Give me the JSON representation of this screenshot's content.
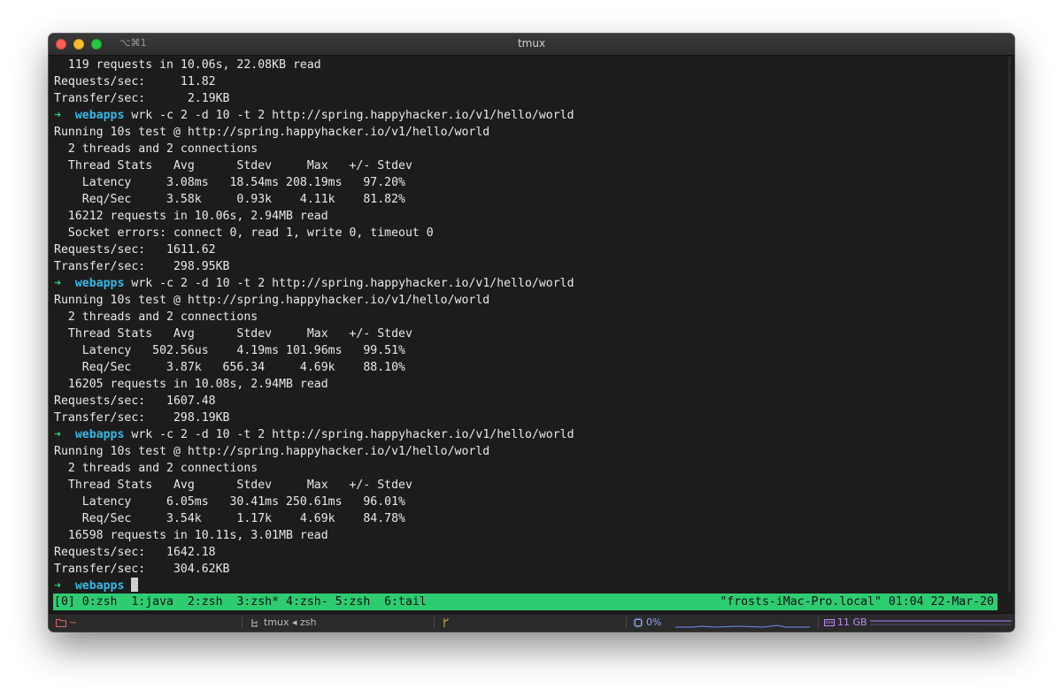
{
  "window": {
    "title": "tmux",
    "shortcut": "⌥⌘1"
  },
  "terminal": {
    "lines": [
      {
        "type": "text",
        "text": "  119 requests in 10.06s, 22.08KB read"
      },
      {
        "type": "text",
        "text": "Requests/sec:     11.82"
      },
      {
        "type": "text",
        "text": "Transfer/sec:      2.19KB"
      },
      {
        "type": "prompt",
        "arrow": "➜",
        "dir": "webapps",
        "cmd": "wrk -c 2 -d 10 -t 2 http://spring.happyhacker.io/v1/hello/world"
      },
      {
        "type": "text",
        "text": "Running 10s test @ http://spring.happyhacker.io/v1/hello/world"
      },
      {
        "type": "text",
        "text": "  2 threads and 2 connections"
      },
      {
        "type": "text",
        "text": "  Thread Stats   Avg      Stdev     Max   +/- Stdev"
      },
      {
        "type": "text",
        "text": "    Latency     3.08ms   18.54ms 208.19ms   97.20%"
      },
      {
        "type": "text",
        "text": "    Req/Sec     3.58k     0.93k    4.11k    81.82%"
      },
      {
        "type": "text",
        "text": "  16212 requests in 10.06s, 2.94MB read"
      },
      {
        "type": "text",
        "text": "  Socket errors: connect 0, read 1, write 0, timeout 0"
      },
      {
        "type": "text",
        "text": "Requests/sec:   1611.62"
      },
      {
        "type": "text",
        "text": "Transfer/sec:    298.95KB"
      },
      {
        "type": "prompt",
        "arrow": "➜",
        "dir": "webapps",
        "cmd": "wrk -c 2 -d 10 -t 2 http://spring.happyhacker.io/v1/hello/world"
      },
      {
        "type": "text",
        "text": "Running 10s test @ http://spring.happyhacker.io/v1/hello/world"
      },
      {
        "type": "text",
        "text": "  2 threads and 2 connections"
      },
      {
        "type": "text",
        "text": "  Thread Stats   Avg      Stdev     Max   +/- Stdev"
      },
      {
        "type": "text",
        "text": "    Latency   502.56us    4.19ms 101.96ms   99.51%"
      },
      {
        "type": "text",
        "text": "    Req/Sec     3.87k   656.34     4.69k    88.10%"
      },
      {
        "type": "text",
        "text": "  16205 requests in 10.08s, 2.94MB read"
      },
      {
        "type": "text",
        "text": "Requests/sec:   1607.48"
      },
      {
        "type": "text",
        "text": "Transfer/sec:    298.19KB"
      },
      {
        "type": "prompt",
        "arrow": "➜",
        "dir": "webapps",
        "cmd": "wrk -c 2 -d 10 -t 2 http://spring.happyhacker.io/v1/hello/world"
      },
      {
        "type": "text",
        "text": "Running 10s test @ http://spring.happyhacker.io/v1/hello/world"
      },
      {
        "type": "text",
        "text": "  2 threads and 2 connections"
      },
      {
        "type": "text",
        "text": "  Thread Stats   Avg      Stdev     Max   +/- Stdev"
      },
      {
        "type": "text",
        "text": "    Latency     6.05ms   30.41ms 250.61ms   96.01%"
      },
      {
        "type": "text",
        "text": "    Req/Sec     3.54k     1.17k    4.69k    84.78%"
      },
      {
        "type": "text",
        "text": "  16598 requests in 10.11s, 3.01MB read"
      },
      {
        "type": "text",
        "text": "Requests/sec:   1642.18"
      },
      {
        "type": "text",
        "text": "Transfer/sec:    304.62KB"
      },
      {
        "type": "prompt-current",
        "arrow": "➜",
        "dir": "webapps",
        "cmd": ""
      }
    ]
  },
  "tmux_status": {
    "left": "[0] 0:zsh  1:java  2:zsh  3:zsh* 4:zsh- 5:zsh  6:tail",
    "right": "\"frosts-iMac-Pro.local\" 01:04 22-Mar-20"
  },
  "bottom_bar": {
    "folder_icon": "folder-icon",
    "folder_label": "~",
    "session_icon": "tmux-session-icon",
    "session_label": "tmux ◂ zsh",
    "branch_icon": "git-branch-icon",
    "cpu_icon": "cpu-icon",
    "cpu_label": "0%",
    "mem_icon": "memory-icon",
    "mem_label": "11 GB"
  },
  "colors": {
    "prompt_arrow": "#2ecc71",
    "prompt_dir": "#35b9e6",
    "tmux_status_bg": "#2ecc71",
    "terminal_bg": "#1c1c1c"
  }
}
